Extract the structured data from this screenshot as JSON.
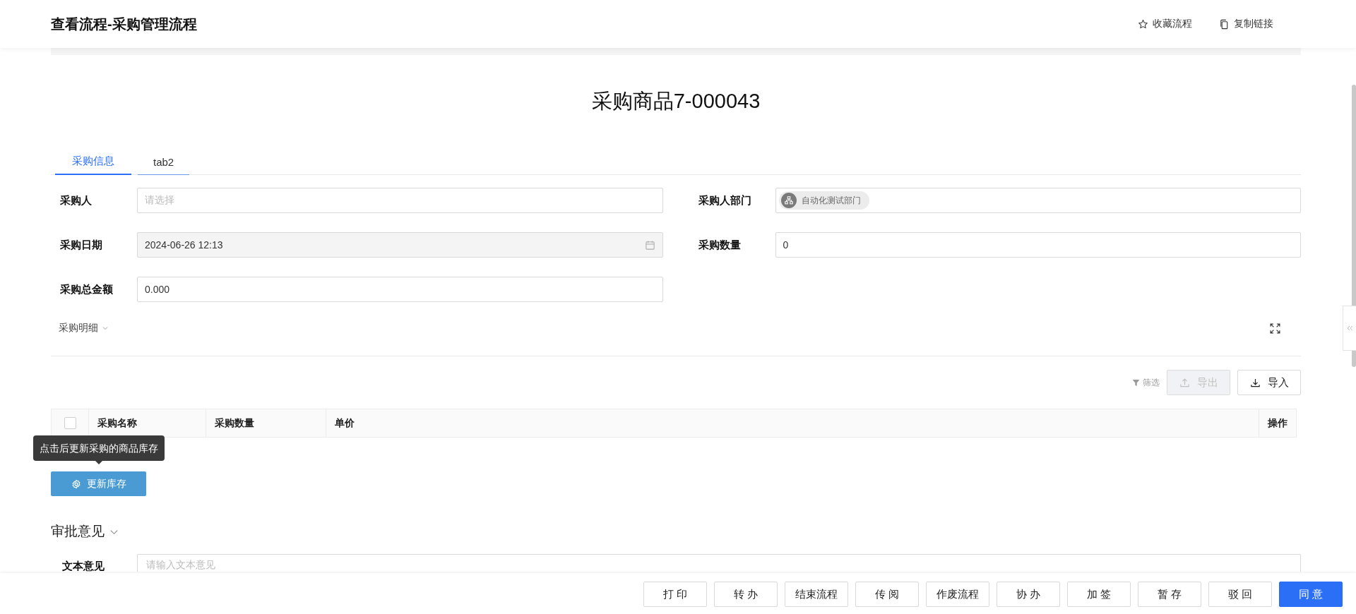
{
  "header": {
    "title": "查看流程-采购管理流程",
    "actions": [
      {
        "kind": "favorite",
        "label": "收藏流程"
      },
      {
        "kind": "copy",
        "label": "复制链接"
      }
    ]
  },
  "document_title": "采购商品7-000043",
  "tabs": [
    {
      "label": "采购信息",
      "selected": true
    },
    {
      "label": "tab2",
      "selected": false
    }
  ],
  "fields": [
    {
      "kind": "select",
      "label": "采购人",
      "placeholder": "请选择"
    },
    {
      "kind": "tag",
      "label": "采购人部门",
      "value": "自动化测试部门"
    },
    {
      "kind": "date",
      "label": "采购日期",
      "value": "2024-06-26 12:13",
      "disabled": true
    },
    {
      "kind": "text",
      "label": "采购数量",
      "value": "0"
    },
    {
      "kind": "text",
      "label": "采购总金额",
      "value": "0.000"
    }
  ],
  "detail_section": {
    "title": "采购明细"
  },
  "toolbar": [
    {
      "kind": "filter",
      "label": "筛选"
    },
    {
      "kind": "export",
      "label": "导出",
      "disabled": true
    },
    {
      "kind": "import",
      "label": "导入",
      "disabled": false
    }
  ],
  "table": {
    "select_all_checked": false,
    "columns": [
      "采购名称",
      "采购数量",
      "单价",
      "操作"
    ]
  },
  "tooltip": "点击后更新采购的商品库存",
  "update_button": "更新库存",
  "approval": {
    "title": "审批意见",
    "fields": [
      {
        "label": "文本意见",
        "placeholder": "请输入文本意见"
      }
    ]
  },
  "footer_buttons": [
    {
      "label": "打 印",
      "primary": false
    },
    {
      "label": "转 办",
      "primary": false
    },
    {
      "label": "结束流程",
      "primary": false
    },
    {
      "label": "传 阅",
      "primary": false
    },
    {
      "label": "作废流程",
      "primary": false
    },
    {
      "label": "协 办",
      "primary": false
    },
    {
      "label": "加 签",
      "primary": false
    },
    {
      "label": "暂 存",
      "primary": false
    },
    {
      "label": "驳 回",
      "primary": false
    },
    {
      "label": "同 意",
      "primary": true
    }
  ]
}
